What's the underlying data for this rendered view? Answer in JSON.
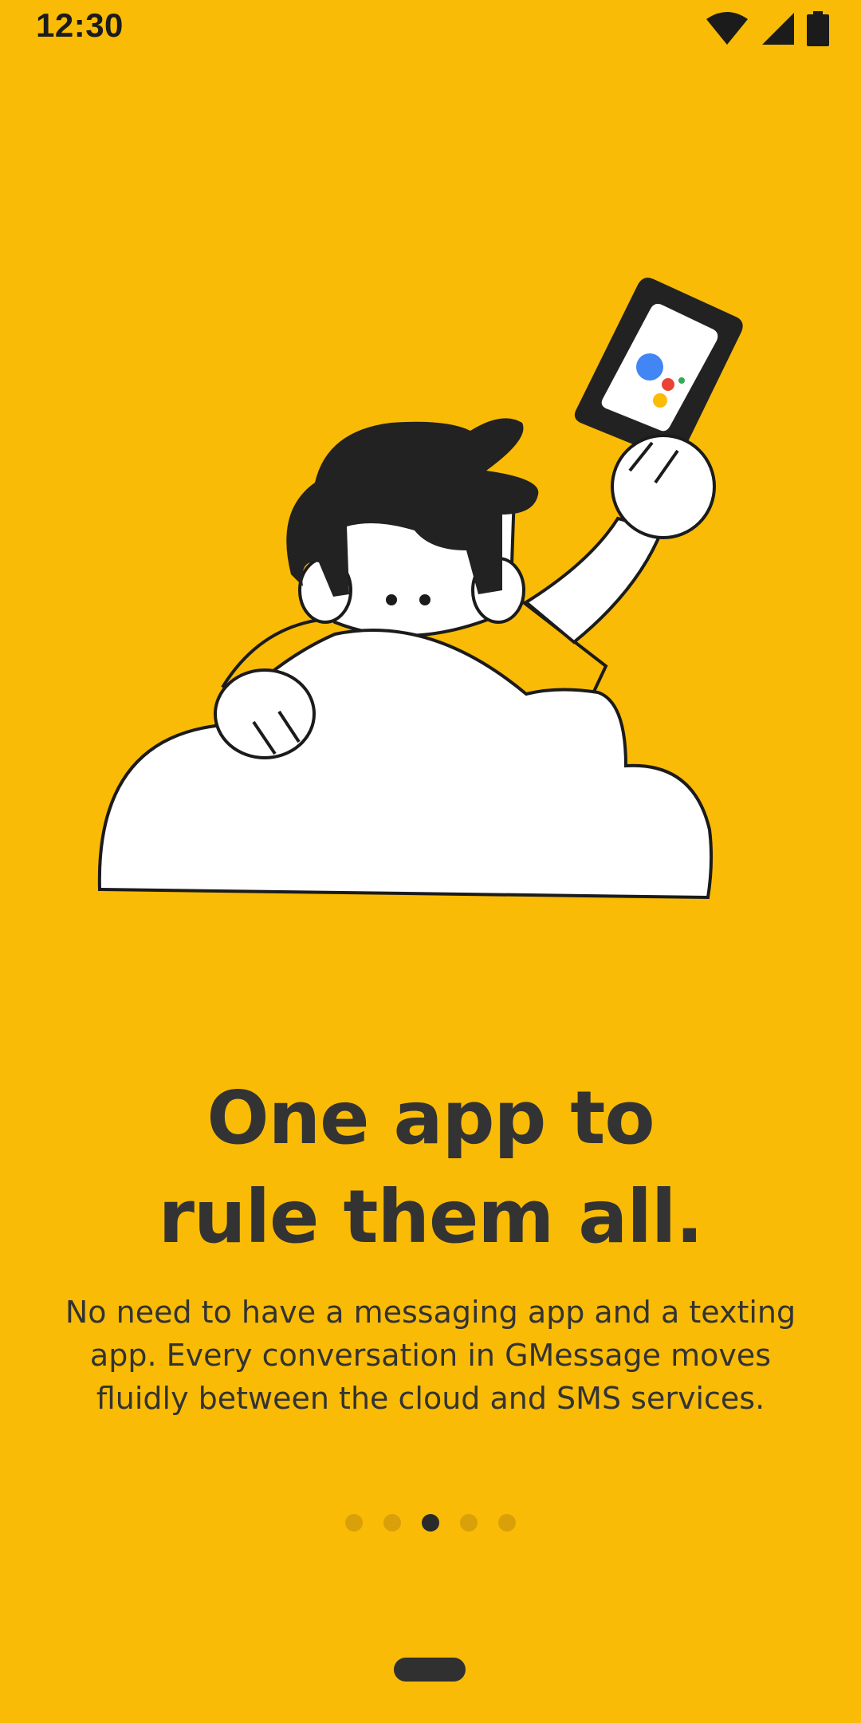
{
  "status_bar": {
    "time": "12:30"
  },
  "onboarding": {
    "title_line1": "One app to",
    "title_line2": "rule them all.",
    "description": "No need to have a messaging app and a texting app. Every conversation in GMessage moves fluidly between the cloud and SMS services.",
    "page_count": 5,
    "active_page": 3
  },
  "colors": {
    "background": "#F9BB06",
    "text": "#333333",
    "dot_inactive": "#D9A00A",
    "dot_active": "#2a2a2a"
  },
  "icons": {
    "wifi": "wifi-icon",
    "signal": "cell-signal-icon",
    "battery": "battery-icon",
    "illustration": "person-on-cloud-illustration"
  }
}
